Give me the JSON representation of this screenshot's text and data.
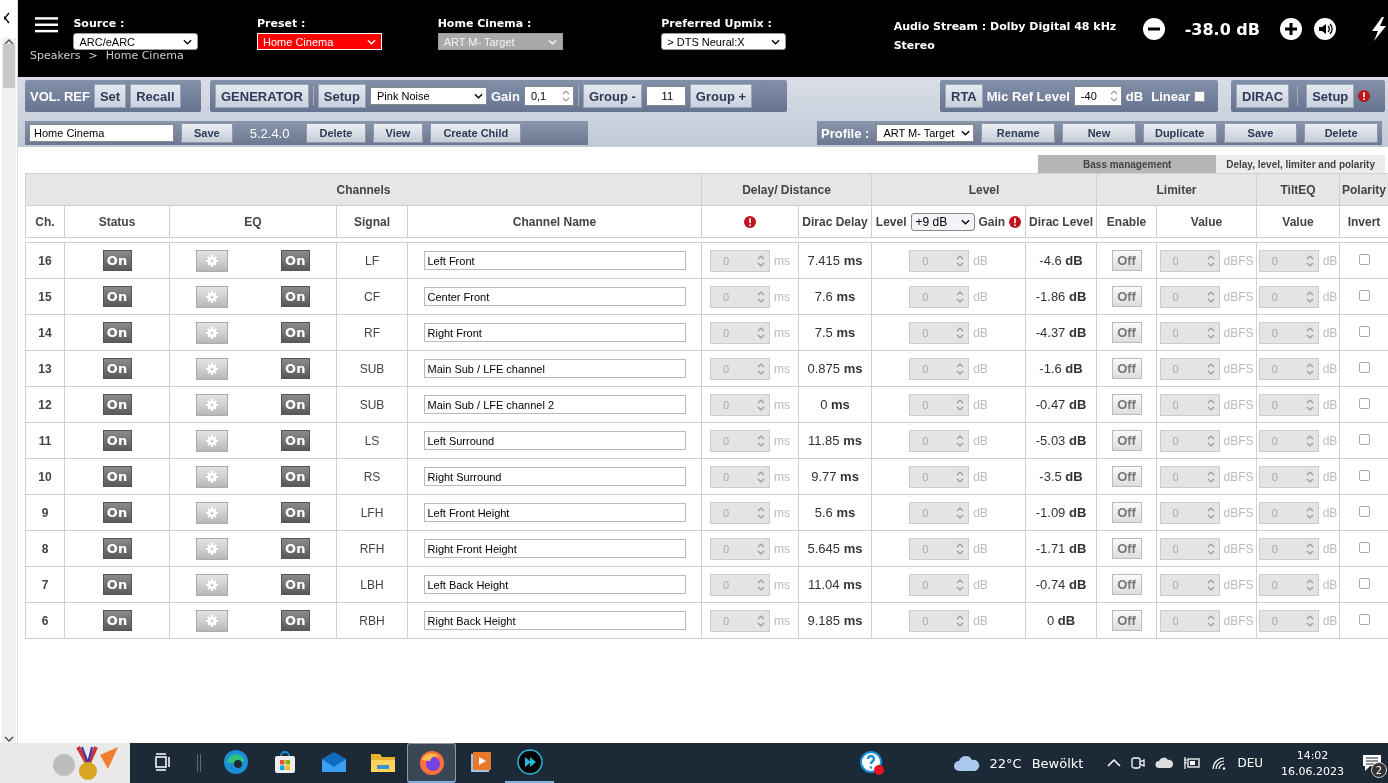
{
  "header": {
    "source": {
      "label": "Source :",
      "value": "ARC/eARC"
    },
    "preset": {
      "label": "Preset :",
      "value": "Home Cinema",
      "alert": true
    },
    "home_cinema": {
      "label": "Home Cinema :",
      "value": "ART M- Target",
      "disabled": true
    },
    "upmix": {
      "label": "Preferred Upmix :",
      "value": "> DTS Neural:X"
    },
    "breadcrumb": [
      "Speakers",
      ">",
      "Home Cinema"
    ],
    "audio_stream": "Audio Stream : Dolby Digital 48 kHz",
    "audio_format": "Stereo",
    "volume": "-38.0 dB"
  },
  "toolbar": {
    "vol_ref": {
      "label": "VOL. REF",
      "buttons": [
        "Set",
        "Recall"
      ]
    },
    "generator": {
      "button": "GENERATOR",
      "setup": "Setup",
      "signal": "Pink Noise",
      "gain_label": "Gain",
      "gain": "0,1",
      "group_minus": "Group -",
      "group": "11",
      "group_plus": "Group +"
    },
    "rta": {
      "button": "RTA",
      "label": "Mic Ref Level",
      "value": "-40",
      "unit": "dB",
      "linear_label": "Linear",
      "linear": false
    },
    "dirac": {
      "button": "DIRAC",
      "setup": "Setup"
    },
    "preset_bar": {
      "name": "Home Cinema",
      "buttons": [
        {
          "kind": "button",
          "label": "Save"
        },
        {
          "kind": "version",
          "label": "5.2.4.0"
        },
        {
          "kind": "button",
          "label": "Delete"
        },
        {
          "kind": "button",
          "label": "View"
        },
        {
          "kind": "button",
          "label": "Create Child"
        }
      ]
    },
    "profile_bar": {
      "label": "Profile :",
      "value": "ART M- Target",
      "buttons": [
        "Rename",
        "New",
        "Duplicate",
        "Save",
        "Delete"
      ]
    }
  },
  "tabs": [
    {
      "label": "Bass management",
      "selected": false
    },
    {
      "label": "Delay, level, limiter and polarity",
      "selected": true
    }
  ],
  "table": {
    "groups": [
      "Channels",
      "Delay/ Distance",
      "Level",
      "Limiter",
      "TiltEQ",
      "Polarity"
    ],
    "columns": [
      {
        "kind": "text",
        "label": "Ch."
      },
      {
        "kind": "text",
        "label": "Status"
      },
      {
        "kind": "text",
        "label": "EQ"
      },
      {
        "kind": "text",
        "label": "Signal"
      },
      {
        "kind": "text",
        "label": "Channel Name"
      },
      {
        "kind": "alert"
      },
      {
        "kind": "text",
        "label": "Dirac Delay"
      },
      {
        "kind": "level",
        "label": "Level",
        "value": "+9 dB",
        "suffix": "Gain"
      },
      {
        "kind": "text",
        "label": "Dirac Level"
      },
      {
        "kind": "text",
        "label": "Enable"
      },
      {
        "kind": "text",
        "label": "Value"
      },
      {
        "kind": "text",
        "label": "Value"
      },
      {
        "kind": "text",
        "label": "Invert"
      }
    ],
    "rows": [
      {
        "ch": "16",
        "status": "On",
        "eq": "On",
        "signal": "LF",
        "name": "Left Front",
        "delay": "0",
        "delay_unit": "ms",
        "dirac_delay": "7.415 **ms**",
        "gain": "0",
        "gain_unit": "dB",
        "dirac_level": "-4.6 **dB**",
        "limiter": "Off",
        "limit_value": "0",
        "limit_unit": "dBFS",
        "tilt": "0",
        "tilt_unit": "dB",
        "invert": false,
        "inputs_disabled": true
      },
      {
        "ch": "15",
        "status": "On",
        "eq": "On",
        "signal": "CF",
        "name": "Center Front",
        "delay": "0",
        "delay_unit": "ms",
        "dirac_delay": "7.6 **ms**",
        "gain": "0",
        "gain_unit": "dB",
        "dirac_level": "-1.86 **dB**",
        "limiter": "Off",
        "limit_value": "0",
        "limit_unit": "dBFS",
        "tilt": "0",
        "tilt_unit": "dB",
        "invert": false,
        "inputs_disabled": true
      },
      {
        "ch": "14",
        "status": "On",
        "eq": "On",
        "signal": "RF",
        "name": "Right Front",
        "delay": "0",
        "delay_unit": "ms",
        "dirac_delay": "7.5 **ms**",
        "gain": "0",
        "gain_unit": "dB",
        "dirac_level": "-4.37 **dB**",
        "limiter": "Off",
        "limit_value": "0",
        "limit_unit": "dBFS",
        "tilt": "0",
        "tilt_unit": "dB",
        "invert": false,
        "inputs_disabled": true
      },
      {
        "ch": "13",
        "status": "On",
        "eq": "On",
        "signal": "SUB",
        "name": "Main Sub / LFE channel",
        "delay": "0",
        "delay_unit": "ms",
        "dirac_delay": "0.875 **ms**",
        "gain": "0",
        "gain_unit": "dB",
        "dirac_level": "-1.6 **dB**",
        "limiter": "Off",
        "limit_value": "0",
        "limit_unit": "dBFS",
        "tilt": "0",
        "tilt_unit": "dB",
        "invert": false,
        "inputs_disabled": true
      },
      {
        "ch": "12",
        "status": "On",
        "eq": "On",
        "signal": "SUB",
        "name": "Main Sub / LFE channel 2",
        "delay": "0",
        "delay_unit": "ms",
        "dirac_delay": "0 **ms**",
        "gain": "0",
        "gain_unit": "dB",
        "dirac_level": "-0.47 **dB**",
        "limiter": "Off",
        "limit_value": "0",
        "limit_unit": "dBFS",
        "tilt": "0",
        "tilt_unit": "dB",
        "invert": false,
        "inputs_disabled": true
      },
      {
        "ch": "11",
        "status": "On",
        "eq": "On",
        "signal": "LS",
        "name": "Left Surround",
        "delay": "0",
        "delay_unit": "ms",
        "dirac_delay": "11.85 **ms**",
        "gain": "0",
        "gain_unit": "dB",
        "dirac_level": "-5.03 **dB**",
        "limiter": "Off",
        "limit_value": "0",
        "limit_unit": "dBFS",
        "tilt": "0",
        "tilt_unit": "dB",
        "invert": false,
        "inputs_disabled": true
      },
      {
        "ch": "10",
        "status": "On",
        "eq": "On",
        "signal": "RS",
        "name": "Right Surround",
        "delay": "0",
        "delay_unit": "ms",
        "dirac_delay": "9.77 **ms**",
        "gain": "0",
        "gain_unit": "dB",
        "dirac_level": "-3.5 **dB**",
        "limiter": "Off",
        "limit_value": "0",
        "limit_unit": "dBFS",
        "tilt": "0",
        "tilt_unit": "dB",
        "invert": false,
        "inputs_disabled": true
      },
      {
        "ch": "9",
        "status": "On",
        "eq": "On",
        "signal": "LFH",
        "name": "Left Front Height",
        "delay": "0",
        "delay_unit": "ms",
        "dirac_delay": "5.6 **ms**",
        "gain": "0",
        "gain_unit": "dB",
        "dirac_level": "-1.09 **dB**",
        "limiter": "Off",
        "limit_value": "0",
        "limit_unit": "dBFS",
        "tilt": "0",
        "tilt_unit": "dB",
        "invert": false,
        "inputs_disabled": true
      },
      {
        "ch": "8",
        "status": "On",
        "eq": "On",
        "signal": "RFH",
        "name": "Right Front Height",
        "delay": "0",
        "delay_unit": "ms",
        "dirac_delay": "5.645 **ms**",
        "gain": "0",
        "gain_unit": "dB",
        "dirac_level": "-1.71 **dB**",
        "limiter": "Off",
        "limit_value": "0",
        "limit_unit": "dBFS",
        "tilt": "0",
        "tilt_unit": "dB",
        "invert": false,
        "inputs_disabled": true
      },
      {
        "ch": "7",
        "status": "On",
        "eq": "On",
        "signal": "LBH",
        "name": "Left Back Height",
        "delay": "0",
        "delay_unit": "ms",
        "dirac_delay": "11.04 **ms**",
        "gain": "0",
        "gain_unit": "dB",
        "dirac_level": "-0.74 **dB**",
        "limiter": "Off",
        "limit_value": "0",
        "limit_unit": "dBFS",
        "tilt": "0",
        "tilt_unit": "dB",
        "invert": false,
        "inputs_disabled": true
      },
      {
        "ch": "6",
        "status": "On",
        "eq": "On",
        "signal": "RBH",
        "name": "Right Back Height",
        "delay": "0",
        "delay_unit": "ms",
        "dirac_delay": "9.185 **ms**",
        "gain": "0",
        "gain_unit": "dB",
        "dirac_level": "0 **dB**",
        "limiter": "Off",
        "limit_value": "0",
        "limit_unit": "dBFS",
        "tilt": "0",
        "tilt_unit": "dB",
        "invert": false,
        "inputs_disabled": true
      }
    ]
  },
  "taskbar": {
    "apps": [
      {
        "kind": "taskview",
        "selected": false,
        "running": false
      },
      {
        "kind": "edge",
        "selected": false,
        "running": false
      },
      {
        "kind": "store",
        "selected": false,
        "running": false
      },
      {
        "kind": "mail",
        "selected": false,
        "running": false
      },
      {
        "kind": "folder",
        "selected": false,
        "running": false
      },
      {
        "kind": "firefox",
        "selected": true,
        "running": true
      },
      {
        "kind": "player",
        "selected": false,
        "running": false
      },
      {
        "kind": "media",
        "selected": false,
        "running": true
      }
    ],
    "temperature": "22°C",
    "weather": "Bewölkt",
    "language": "DEU",
    "time": "14:02",
    "date": "16.06.2023",
    "notifications": "2"
  }
}
